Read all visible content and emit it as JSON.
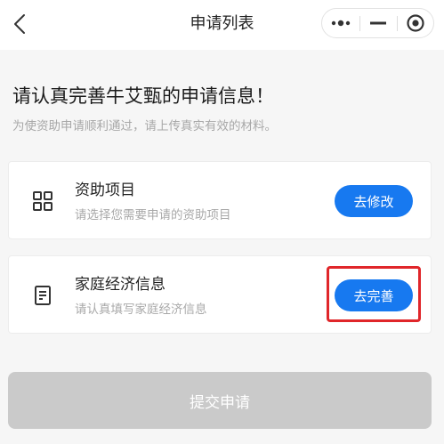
{
  "nav": {
    "title": "申请列表",
    "back_icon": "chevron-left-icon",
    "capsule_icons": [
      "more-dots-icon",
      "minimize-icon",
      "target-close-icon"
    ]
  },
  "header": {
    "headline": "请认真完善牛艾甄的申请信息！",
    "subline": "为使资助申请顺利通过，请上传真实有效的材料。"
  },
  "cards": [
    {
      "title": "资助项目",
      "subtitle": "请选择您需要申请的资助项目",
      "button_label": "去修改",
      "icon": "grid-icon"
    },
    {
      "title": "家庭经济信息",
      "subtitle": "请认真填写家庭经济信息",
      "button_label": "去完善",
      "icon": "document-icon",
      "highlighted": true
    }
  ],
  "submit": {
    "label": "提交申请",
    "disabled": true
  },
  "colors": {
    "primary": "#1779f0",
    "highlight": "#e0262a",
    "disabled": "#cacaca",
    "background": "#f6f6f6"
  }
}
